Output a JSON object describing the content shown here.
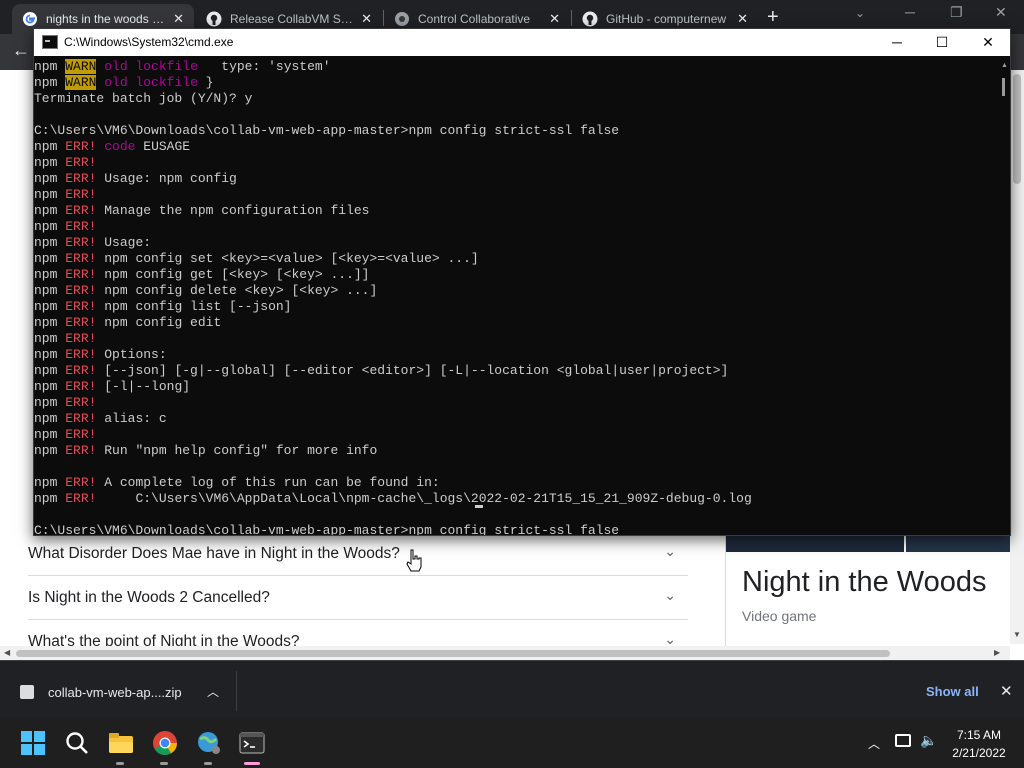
{
  "browser": {
    "tabs": [
      {
        "title": "nights in the woods - G",
        "favicon": "google-g-icon",
        "active": true
      },
      {
        "title": "Release CollabVM Serv",
        "favicon": "github-icon",
        "active": false
      },
      {
        "title": "Control Collaborative",
        "favicon": "collabvm-icon",
        "active": false
      },
      {
        "title": "GitHub - computernew",
        "favicon": "github-icon",
        "active": false
      }
    ],
    "tab_close": "✕",
    "new_tab": "+"
  },
  "page": {
    "faqs": [
      "What Disorder Does Mae have in Night in the Woods?",
      "Is Night in the Woods 2 Cancelled?",
      "What's the point of Night in the Woods?"
    ],
    "knowledge_panel": {
      "title": "Night in the Woods",
      "subtitle": "Video game"
    }
  },
  "cmd": {
    "title": "C:\\Windows\\System32\\cmd.exe",
    "lines": [
      [
        {
          "t": "npm "
        },
        {
          "t": "WARN",
          "c": "warn"
        },
        {
          "t": " "
        },
        {
          "t": "old lockfile",
          "c": "mag"
        },
        {
          "t": "   type: 'system'"
        }
      ],
      [
        {
          "t": "npm "
        },
        {
          "t": "WARN",
          "c": "warn"
        },
        {
          "t": " "
        },
        {
          "t": "old lockfile",
          "c": "mag"
        },
        {
          "t": " }"
        }
      ],
      [
        {
          "t": "Terminate batch job (Y/N)? y"
        }
      ],
      [
        {
          "t": ""
        }
      ],
      [
        {
          "t": "C:\\Users\\VM6\\Downloads\\collab-vm-web-app-master>npm config strict-ssl false"
        }
      ],
      [
        {
          "t": "npm "
        },
        {
          "t": "ERR!",
          "c": "err"
        },
        {
          "t": " "
        },
        {
          "t": "code",
          "c": "mag"
        },
        {
          "t": " EUSAGE"
        }
      ],
      [
        {
          "t": "npm "
        },
        {
          "t": "ERR!",
          "c": "err"
        }
      ],
      [
        {
          "t": "npm "
        },
        {
          "t": "ERR!",
          "c": "err"
        },
        {
          "t": " Usage: npm config"
        }
      ],
      [
        {
          "t": "npm "
        },
        {
          "t": "ERR!",
          "c": "err"
        }
      ],
      [
        {
          "t": "npm "
        },
        {
          "t": "ERR!",
          "c": "err"
        },
        {
          "t": " Manage the npm configuration files"
        }
      ],
      [
        {
          "t": "npm "
        },
        {
          "t": "ERR!",
          "c": "err"
        }
      ],
      [
        {
          "t": "npm "
        },
        {
          "t": "ERR!",
          "c": "err"
        },
        {
          "t": " Usage:"
        }
      ],
      [
        {
          "t": "npm "
        },
        {
          "t": "ERR!",
          "c": "err"
        },
        {
          "t": " npm config set <key>=<value> [<key>=<value> ...]"
        }
      ],
      [
        {
          "t": "npm "
        },
        {
          "t": "ERR!",
          "c": "err"
        },
        {
          "t": " npm config get [<key> [<key> ...]]"
        }
      ],
      [
        {
          "t": "npm "
        },
        {
          "t": "ERR!",
          "c": "err"
        },
        {
          "t": " npm config delete <key> [<key> ...]"
        }
      ],
      [
        {
          "t": "npm "
        },
        {
          "t": "ERR!",
          "c": "err"
        },
        {
          "t": " npm config list [--json]"
        }
      ],
      [
        {
          "t": "npm "
        },
        {
          "t": "ERR!",
          "c": "err"
        },
        {
          "t": " npm config edit"
        }
      ],
      [
        {
          "t": "npm "
        },
        {
          "t": "ERR!",
          "c": "err"
        }
      ],
      [
        {
          "t": "npm "
        },
        {
          "t": "ERR!",
          "c": "err"
        },
        {
          "t": " Options:"
        }
      ],
      [
        {
          "t": "npm "
        },
        {
          "t": "ERR!",
          "c": "err"
        },
        {
          "t": " [--json] [-g|--global] [--editor <editor>] [-L|--location <global|user|project>]"
        }
      ],
      [
        {
          "t": "npm "
        },
        {
          "t": "ERR!",
          "c": "err"
        },
        {
          "t": " [-l|--long]"
        }
      ],
      [
        {
          "t": "npm "
        },
        {
          "t": "ERR!",
          "c": "err"
        }
      ],
      [
        {
          "t": "npm "
        },
        {
          "t": "ERR!",
          "c": "err"
        },
        {
          "t": " alias: c"
        }
      ],
      [
        {
          "t": "npm "
        },
        {
          "t": "ERR!",
          "c": "err"
        }
      ],
      [
        {
          "t": "npm "
        },
        {
          "t": "ERR!",
          "c": "err"
        },
        {
          "t": " Run \"npm help config\" for more info"
        }
      ],
      [
        {
          "t": ""
        }
      ],
      [
        {
          "t": "npm "
        },
        {
          "t": "ERR!",
          "c": "err"
        },
        {
          "t": " A complete log of this run can be found in:"
        }
      ],
      [
        {
          "t": "npm "
        },
        {
          "t": "ERR!",
          "c": "err"
        },
        {
          "t": "     C:\\Users\\VM6\\AppData\\Local\\npm-cache\\_logs\\2022-02-21T15_15_21_909Z-debug-0.log"
        }
      ],
      [
        {
          "t": ""
        }
      ],
      [
        {
          "t": "C:\\Users\\VM6\\Downloads\\collab-vm-web-app-master>npm config strict-ssl false"
        }
      ]
    ]
  },
  "downloads": {
    "file_name": "collab-vm-web-ap....zip",
    "show_all": "Show all"
  },
  "taskbar": {
    "time": "7:15 AM",
    "date": "2/21/2022"
  },
  "colors": {
    "cmd_bg": "#0c0c0c",
    "err": "#e74856",
    "warn_bg": "#c19c00",
    "keyword": "#b4009e",
    "link": "#8ab4f8"
  }
}
